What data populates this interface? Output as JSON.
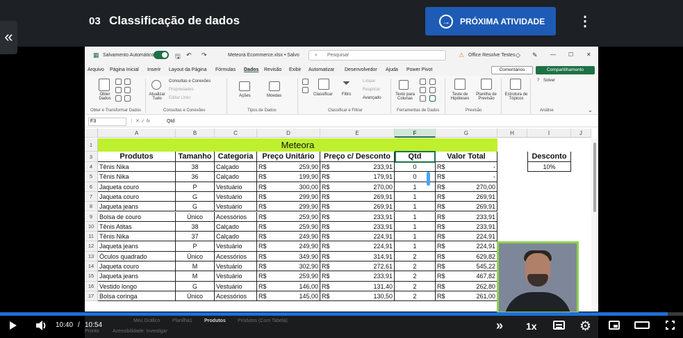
{
  "course": {
    "lesson_number": "03",
    "lesson_title": "Classificação de dados",
    "next_button": "PRÓXIMA ATIVIDADE",
    "back_icon": "double-chevron-left-icon",
    "next_icon": "arrow-circle-right-icon",
    "menu_icon": "kebab-menu-icon"
  },
  "excel": {
    "autosave_label": "Salvamento Automático",
    "file_name": "Meteora Ecommerce.xlsx • Salvo",
    "search_placeholder": "Pesquisar",
    "user_name": "Office Resolve Testes",
    "menu": [
      "Arquivo",
      "Página Inicial",
      "Inserir",
      "Layout da Página",
      "Fórmulas",
      "Dados",
      "Revisão",
      "Exibir",
      "Automatizar",
      "Desenvolvedor",
      "Ajuda",
      "Power Pivot"
    ],
    "active_menu": "Dados",
    "comments_button": "Comentários",
    "share_button": "Compartilhamento",
    "ribbon": {
      "obter_dados": "Obter Dados",
      "consultas_conexoes": "Consultas e Conexões",
      "propriedades": "Propriedades",
      "editar_links": "Editar Links",
      "atualizar_tudo": "Atualizar Tudo",
      "acoes": "Ações",
      "moedas": "Moedas",
      "classificar": "Classificar",
      "filtro": "Filtro",
      "limpar": "Limpar",
      "reaplicar": "Reaplicar",
      "avancado": "Avançado",
      "texto_colunas": "Texto para Colunas",
      "teste_hipoteses": "Teste de Hipóteses",
      "planilha_previsao": "Planilha de Previsão",
      "estrutura_topicos": "Estrutura de Tópicos",
      "solver": "Solver",
      "groups": [
        "Obter e Transformar Dados",
        "Consultas e Conexões",
        "Tipos de Dados",
        "Classificar e Filtrar",
        "Ferramentas de Dados",
        "Previsão",
        "Análise"
      ]
    },
    "name_box": "F3",
    "formula": "Qtd",
    "columns": [
      "A",
      "B",
      "C",
      "D",
      "E",
      "F",
      "G",
      "H",
      "I",
      "J"
    ],
    "selected_column": "F",
    "sheet_title": "Meteora",
    "headers": [
      "Produtos",
      "Tamanho",
      "Categoria",
      "Preço Unitário",
      "Preço c/ Desconto",
      "Qtd",
      "Valor Total"
    ],
    "currency": "R$",
    "discount_label": "Desconto",
    "discount_value": "10%",
    "rows": [
      {
        "n": "4",
        "produto": "Tênis Nika",
        "tamanho": "38",
        "categoria": "Calçado",
        "preco": "259,90",
        "desconto": "233,91",
        "qtd": "0",
        "total": "-"
      },
      {
        "n": "5",
        "produto": "Tênis Nika",
        "tamanho": "36",
        "categoria": "Calçado",
        "preco": "199,90",
        "desconto": "179,91",
        "qtd": "0",
        "total": "-"
      },
      {
        "n": "6",
        "produto": "Jaqueta couro",
        "tamanho": "P",
        "categoria": "Vestuário",
        "preco": "300,00",
        "desconto": "270,00",
        "qtd": "1",
        "total": "270,00"
      },
      {
        "n": "7",
        "produto": "Jaqueta couro",
        "tamanho": "G",
        "categoria": "Vestuário",
        "preco": "299,90",
        "desconto": "269,91",
        "qtd": "1",
        "total": "269,91"
      },
      {
        "n": "8",
        "produto": "Jaqueta jeans",
        "tamanho": "G",
        "categoria": "Vestuário",
        "preco": "299,90",
        "desconto": "269,91",
        "qtd": "1",
        "total": "269,91"
      },
      {
        "n": "9",
        "produto": "Bolsa de couro",
        "tamanho": "Único",
        "categoria": "Acessórios",
        "preco": "259,90",
        "desconto": "233,91",
        "qtd": "1",
        "total": "233,91"
      },
      {
        "n": "10",
        "produto": "Tênis Atitas",
        "tamanho": "38",
        "categoria": "Calçado",
        "preco": "259,90",
        "desconto": "233,91",
        "qtd": "1",
        "total": "233,91"
      },
      {
        "n": "11",
        "produto": "Tênis Nika",
        "tamanho": "37",
        "categoria": "Calçado",
        "preco": "249,90",
        "desconto": "224,91",
        "qtd": "1",
        "total": "224,91"
      },
      {
        "n": "12",
        "produto": "Jaqueta jeans",
        "tamanho": "P",
        "categoria": "Vestuário",
        "preco": "249,90",
        "desconto": "224,91",
        "qtd": "1",
        "total": "224,91"
      },
      {
        "n": "13",
        "produto": "Óculos quadrado",
        "tamanho": "Único",
        "categoria": "Acessórios",
        "preco": "349,90",
        "desconto": "314,91",
        "qtd": "2",
        "total": "629,82"
      },
      {
        "n": "14",
        "produto": "Jaqueta couro",
        "tamanho": "M",
        "categoria": "Vestuário",
        "preco": "302,90",
        "desconto": "272,61",
        "qtd": "2",
        "total": "545,22"
      },
      {
        "n": "15",
        "produto": "Jaqueta jeans",
        "tamanho": "M",
        "categoria": "Vestuário",
        "preco": "259,90",
        "desconto": "233,91",
        "qtd": "2",
        "total": "467,82"
      },
      {
        "n": "16",
        "produto": "Vestido longo",
        "tamanho": "G",
        "categoria": "Vestuário",
        "preco": "146,00",
        "desconto": "131,40",
        "qtd": "2",
        "total": "262,80"
      },
      {
        "n": "17",
        "produto": "Bolsa coringa",
        "tamanho": "Único",
        "categoria": "Acessórios",
        "preco": "145,00",
        "desconto": "130,50",
        "qtd": "2",
        "total": "261,00"
      }
    ],
    "sheet_tabs": [
      "Meu Gráfico",
      "Planilha1",
      "Produtos",
      "Produtos (Com Tabela)"
    ],
    "active_sheet": "Produtos",
    "status_left": "Pronto",
    "accessibility": "Acessibilidade: Investigar"
  },
  "player": {
    "current_time": "10:40",
    "separator": "/",
    "duration": "10:54",
    "progress": 0.978,
    "speed": "1x",
    "play_icon": "play-icon",
    "volume_icon": "volume-icon",
    "forward_icon": "fast-forward-icon",
    "captions_icon": "captions-icon",
    "settings_icon": "gear-icon",
    "pip_icon": "picture-in-picture-icon",
    "theater_icon": "theater-mode-icon",
    "fullscreen_icon": "fullscreen-icon",
    "accent_color": "#1e6fd9"
  }
}
